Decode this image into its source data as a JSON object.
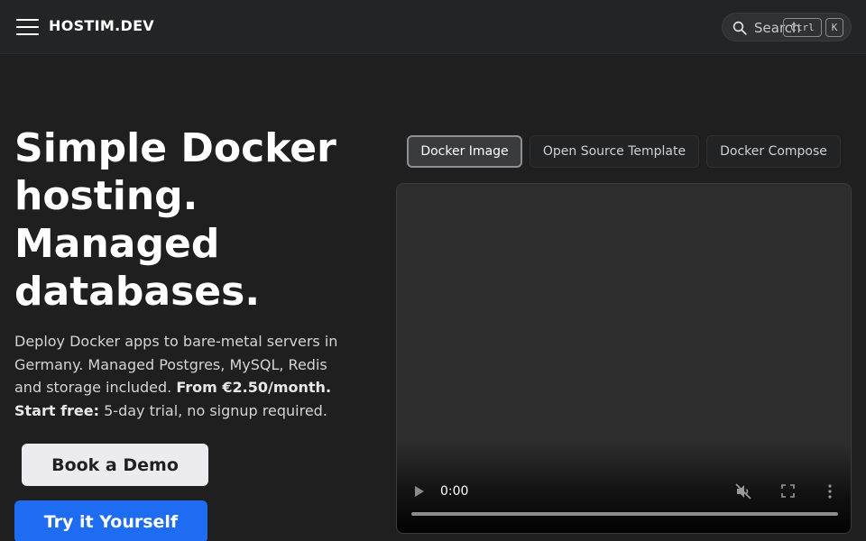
{
  "header": {
    "brand": "HOSTIM.DEV",
    "search": {
      "label": "Search",
      "shortcut_mod": "Ctrl",
      "shortcut_key": "K"
    }
  },
  "hero": {
    "title_lines": [
      "Simple Docker",
      "hosting.",
      "Managed",
      "databases."
    ],
    "description": {
      "text1": "Deploy Docker apps to bare-metal servers in Germany. Managed Postgres, MySQL, Redis and storage included. ",
      "price": "From €2.50/month.",
      "start_label": "Start free:",
      "start_text": " 5-day trial, no signup required."
    },
    "buttons": {
      "demo": "Book a Demo",
      "try": "Try it Yourself"
    }
  },
  "tabs": [
    {
      "label": "Docker Image",
      "active": true
    },
    {
      "label": "Open Source Template",
      "active": false
    },
    {
      "label": "Docker Compose",
      "active": false
    }
  ],
  "video": {
    "time": "0:00",
    "progress": 0,
    "muted": true
  },
  "colors": {
    "background": "#1f1f20",
    "accent": "#1d6cf2",
    "demo_button": "#ececf0"
  }
}
